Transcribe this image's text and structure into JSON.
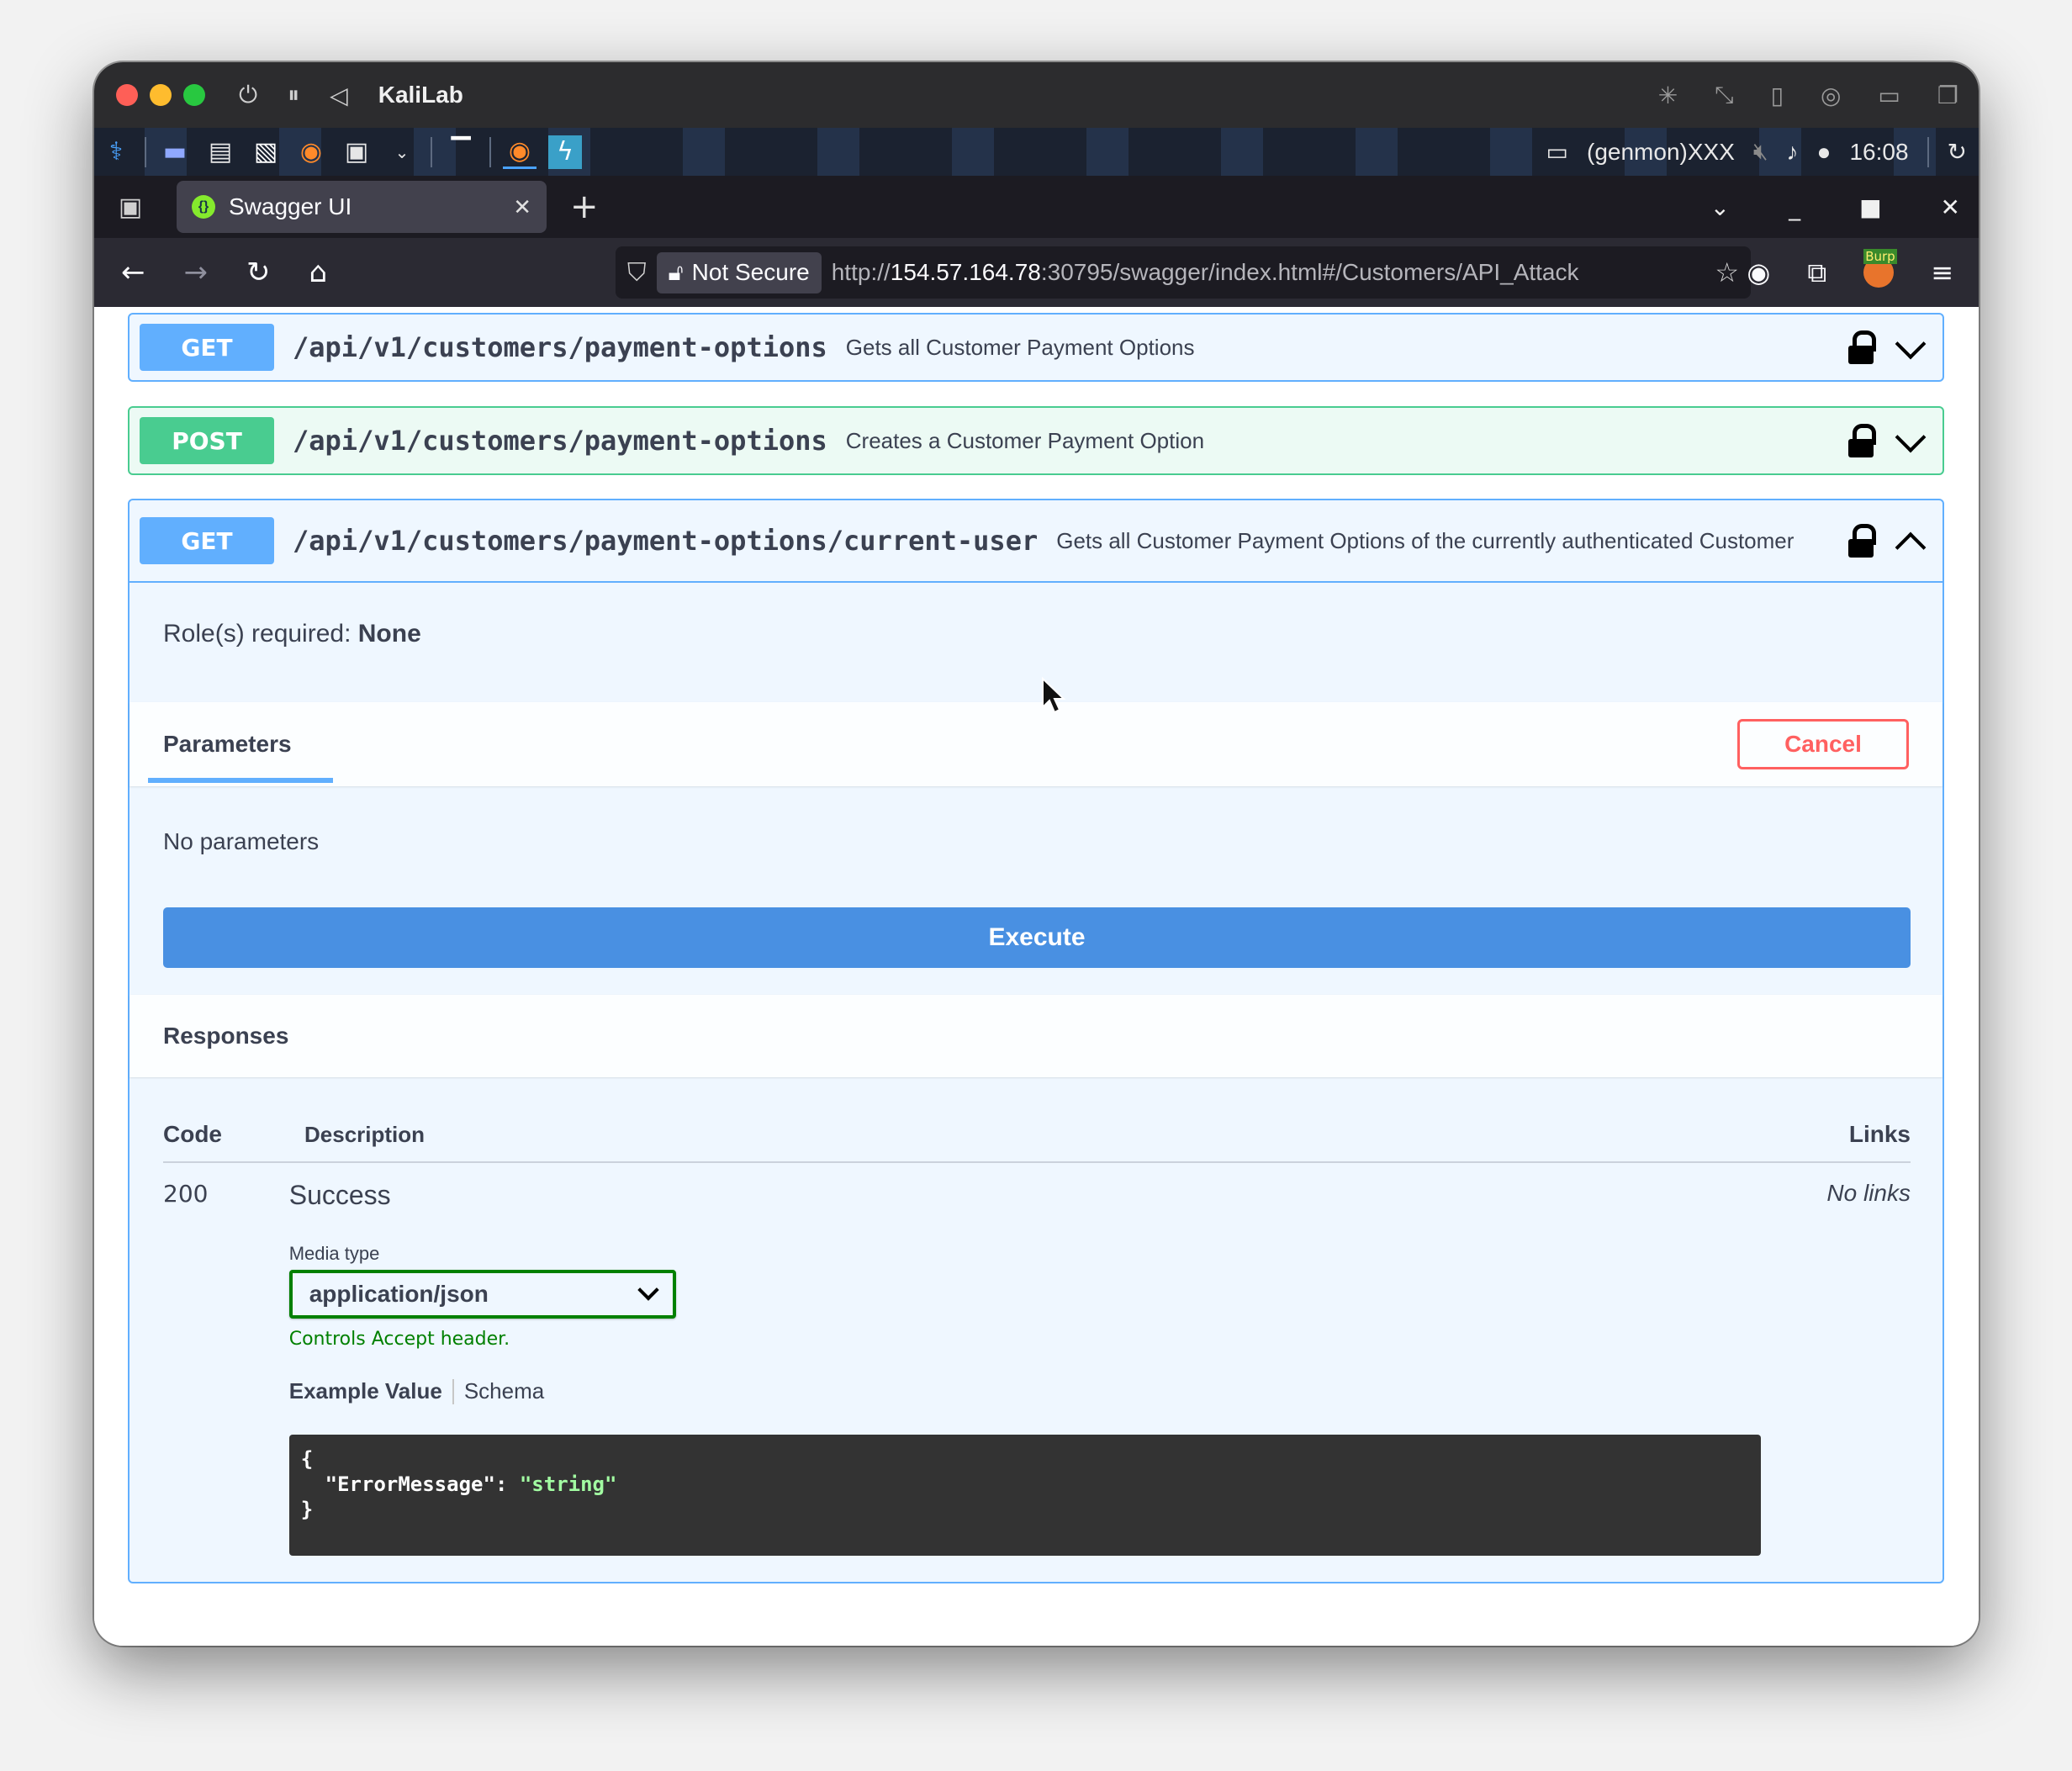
{
  "vm": {
    "title": "KaliLab",
    "controls": [
      "power-icon",
      "pause-icon",
      "back-icon"
    ],
    "right_icons": [
      "brightness-icon",
      "resize-icon",
      "usb-icon",
      "camera-icon",
      "folder-icon",
      "windows-icon"
    ]
  },
  "kali_panel": {
    "genmon": "(genmon)XXX",
    "clock": "16:08"
  },
  "browser": {
    "tab_title": "Swagger UI",
    "tab_close": "✕",
    "new_tab": "+",
    "security_label": "Not Secure",
    "url_scheme": "http://",
    "url_host": "154.57.164.78",
    "url_rest": ":30795/swagger/index.html#/Customers/API_Attack"
  },
  "operations": [
    {
      "method": "GET",
      "path": "/api/v1/customers/payment-options",
      "summary": "Gets all Customer Payment Options",
      "expanded": false
    },
    {
      "method": "POST",
      "path": "/api/v1/customers/payment-options",
      "summary": "Creates a Customer Payment Option",
      "expanded": false
    },
    {
      "method": "GET",
      "path": "/api/v1/customers/payment-options/current-user",
      "summary": "Gets all Customer Payment Options of the currently authenticated Customer",
      "expanded": true
    }
  ],
  "expanded_op": {
    "roles_label": "Role(s) required: ",
    "roles_value": "None",
    "parameters_tab": "Parameters",
    "cancel_label": "Cancel",
    "no_parameters": "No parameters",
    "execute_label": "Execute",
    "responses_title": "Responses",
    "table": {
      "col_code": "Code",
      "col_description": "Description",
      "col_links": "Links"
    },
    "response": {
      "code": "200",
      "description": "Success",
      "links": "No links",
      "media_type_label": "Media type",
      "media_type_value": "application/json",
      "accept_note": "Controls Accept header.",
      "example_tab": "Example Value",
      "schema_tab": "Schema",
      "example": {
        "open": "{",
        "key": "\"ErrorMessage\"",
        "colon": ": ",
        "value": "\"string\"",
        "close": "}"
      }
    }
  },
  "colors": {
    "get": "#61affe",
    "post": "#49cc90",
    "execute": "#4990e2",
    "cancel": "#ff6060"
  }
}
